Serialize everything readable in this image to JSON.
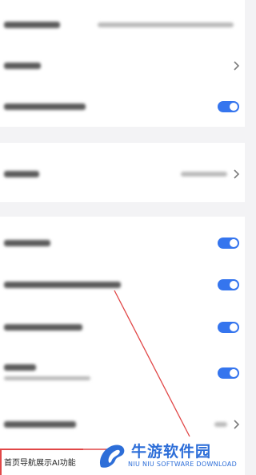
{
  "settings": {
    "download_path": {
      "label": "",
      "value": ""
    },
    "row2": {
      "label": ""
    },
    "row3": {
      "label": "",
      "toggle_on": true
    },
    "row4": {
      "label": "",
      "value": ""
    },
    "row5": {
      "label": "",
      "toggle_on": true
    },
    "row6": {
      "label": "",
      "toggle_on": true
    },
    "row7": {
      "label": "",
      "toggle_on": true
    },
    "row8": {
      "label": "",
      "sublabel": "",
      "toggle_on": true
    },
    "row9": {
      "label": "",
      "value": ""
    },
    "bottom_item": {
      "label": "首页导航展示AI功能"
    }
  },
  "watermark": {
    "cn_text": "牛游软件园",
    "en_text": "NIU NIU SOFTWARE DOWNLOAD",
    "color": "#2d6ed8"
  },
  "colors": {
    "toggle_on": "#3575ee",
    "highlight": "#e14747",
    "background": "#f3f3f5"
  },
  "icons": {
    "chevron": "chevron-right-icon",
    "logo": "niuyou-logo-icon"
  }
}
